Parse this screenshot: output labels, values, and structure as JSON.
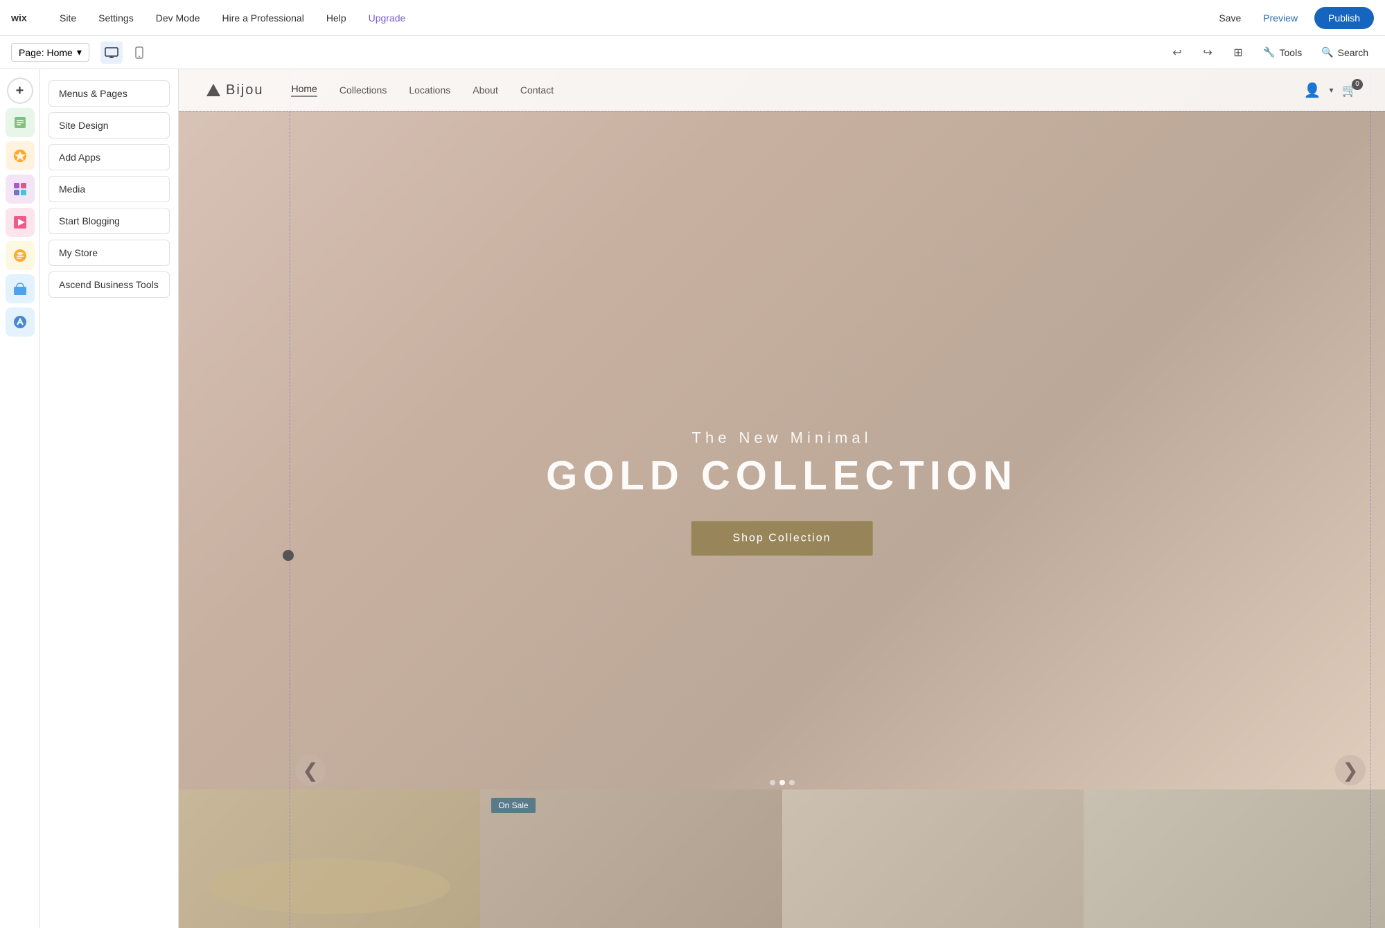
{
  "topbar": {
    "logo": "wix",
    "nav": [
      {
        "label": "Site"
      },
      {
        "label": "Settings"
      },
      {
        "label": "Dev Mode"
      },
      {
        "label": "Hire a Professional"
      },
      {
        "label": "Help"
      },
      {
        "label": "Upgrade"
      }
    ],
    "save_label": "Save",
    "preview_label": "Preview",
    "publish_label": "Publish"
  },
  "pagebar": {
    "page_label": "Page: Home",
    "tools_label": "Tools",
    "search_label": "Search"
  },
  "sidebar": {
    "add_label": "+",
    "icons": [
      {
        "name": "pages-icon",
        "symbol": "☰",
        "class": "pages"
      },
      {
        "name": "design-icon",
        "symbol": "✦",
        "class": "design"
      },
      {
        "name": "apps-icon",
        "symbol": "⊞",
        "class": "apps"
      },
      {
        "name": "media-icon",
        "symbol": "⬛",
        "class": "media"
      },
      {
        "name": "blog-icon",
        "symbol": "✒",
        "class": "blog"
      },
      {
        "name": "store-icon",
        "symbol": "🛍",
        "class": "store"
      },
      {
        "name": "ascend-icon",
        "symbol": "⬆",
        "class": "ascend"
      }
    ]
  },
  "panel": {
    "items": [
      {
        "label": "Menus & Pages"
      },
      {
        "label": "Site Design"
      },
      {
        "label": "Add Apps"
      },
      {
        "label": "Media"
      },
      {
        "label": "Start Blogging"
      },
      {
        "label": "My Store"
      },
      {
        "label": "Ascend Business Tools"
      }
    ]
  },
  "site_header": {
    "logo_text": "Bijou",
    "nav_items": [
      {
        "label": "Home",
        "active": true
      },
      {
        "label": "Collections"
      },
      {
        "label": "Locations"
      },
      {
        "label": "About"
      },
      {
        "label": "Contact"
      }
    ],
    "cart_count": "0"
  },
  "hero": {
    "subtitle": "The New Minimal",
    "title": "GOLD COLLECTION",
    "cta_label": "Shop Collection"
  },
  "products": {
    "on_sale_label": "On Sale",
    "prev_arrow": "❮",
    "next_arrow": "❯"
  },
  "colors": {
    "accent_blue": "#1565C0",
    "upgrade_purple": "#7B5FC9",
    "hero_btn": "rgba(139,120,68,0.75)"
  }
}
